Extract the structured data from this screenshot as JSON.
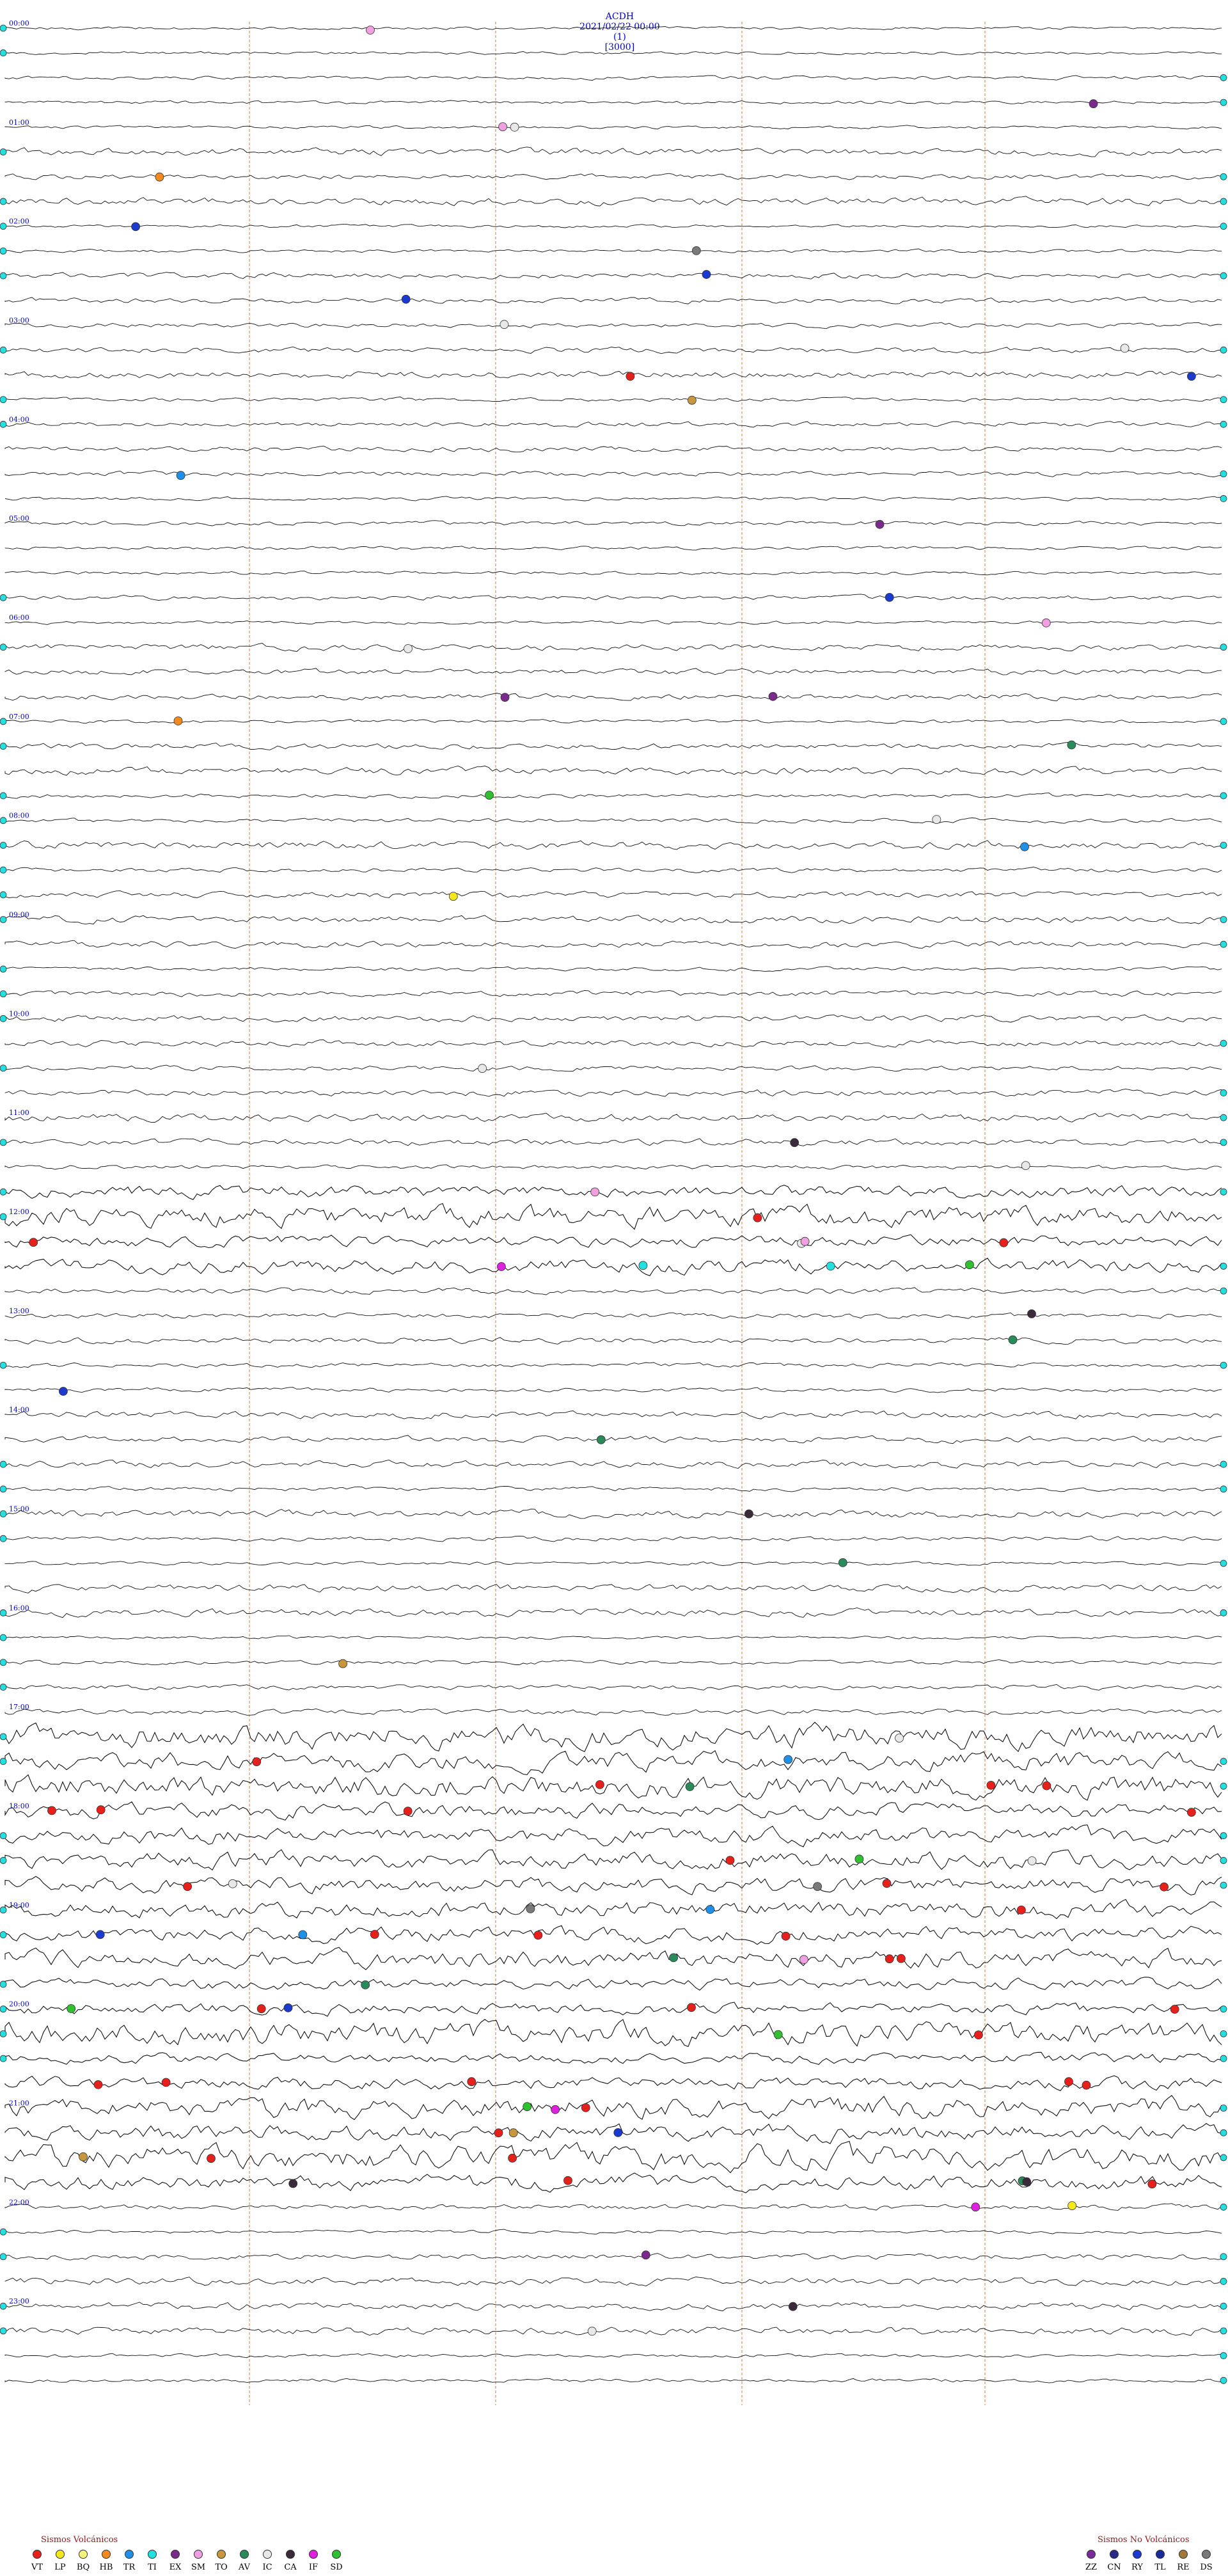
{
  "header": {
    "station": "ACDH",
    "datetime": "2021/02/22 00:00",
    "channel": "(1)",
    "gain": "[3000]"
  },
  "helicorder": {
    "hours_per_page": 24,
    "rows_per_hour": 4,
    "minutes_per_row": 15,
    "hour_labels": [
      "00:00",
      "01:00",
      "02:00",
      "03:00",
      "04:00",
      "05:00",
      "06:00",
      "07:00",
      "08:00",
      "09:00",
      "10:00",
      "11:00",
      "12:00",
      "13:00",
      "14:00",
      "15:00",
      "16:00",
      "17:00",
      "18:00",
      "19:00",
      "20:00",
      "21:00",
      "22:00",
      "23:00"
    ],
    "intense_intervals_hours": [
      [
        11.6,
        12.5
      ],
      [
        17.1,
        21.8
      ]
    ]
  },
  "legend_volcanic": {
    "title": "Sismos Volcánicos",
    "items": [
      {
        "code": "VT",
        "color": "#e8201c"
      },
      {
        "code": "LP",
        "color": "#f2e81a"
      },
      {
        "code": "BQ",
        "color": "#f7f27a"
      },
      {
        "code": "HB",
        "color": "#f28a1e"
      },
      {
        "code": "TR",
        "color": "#1e90e8"
      },
      {
        "code": "TI",
        "color": "#22e0e0"
      },
      {
        "code": "EX",
        "color": "#7a2a8a"
      },
      {
        "code": "SM",
        "color": "#f0a0e0"
      },
      {
        "code": "TO",
        "color": "#c8963c"
      },
      {
        "code": "AV",
        "color": "#2a8a5a"
      },
      {
        "code": "IC",
        "color": "#e8e8e8"
      },
      {
        "code": "CA",
        "color": "#3a2a3a"
      },
      {
        "code": "IF",
        "color": "#e020e0"
      },
      {
        "code": "SD",
        "color": "#30c030"
      }
    ]
  },
  "legend_nonvolcanic": {
    "title": "Sismos No Volcánicos",
    "items": [
      {
        "code": "ZZ",
        "color": "#7a2a9a"
      },
      {
        "code": "CN",
        "color": "#2a2a8a"
      },
      {
        "code": "RY",
        "color": "#1a3ad0"
      },
      {
        "code": "TL",
        "color": "#1a2a9a"
      },
      {
        "code": "RE",
        "color": "#a07a3a"
      },
      {
        "code": "DS",
        "color": "#7a7a7a"
      }
    ]
  }
}
